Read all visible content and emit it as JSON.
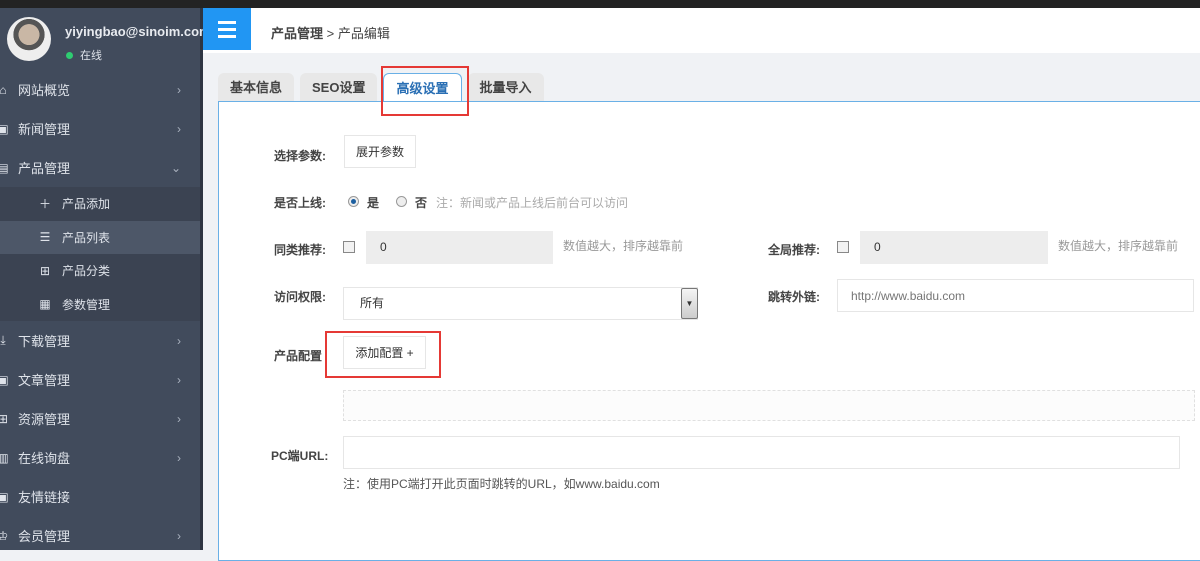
{
  "user": {
    "email": "yiyingbao@sinoim.com",
    "status": "在线"
  },
  "sidebar": {
    "items": [
      {
        "label": "网站概览",
        "icon": "home-icon"
      },
      {
        "label": "新闻管理",
        "icon": "newspaper-icon"
      },
      {
        "label": "产品管理",
        "icon": "file-icon",
        "expanded": true,
        "children": [
          {
            "label": "产品添加",
            "icon": "plus-icon"
          },
          {
            "label": "产品列表",
            "icon": "list-icon",
            "active": true
          },
          {
            "label": "产品分类",
            "icon": "grid-icon"
          },
          {
            "label": "参数管理",
            "icon": "tiles-icon"
          }
        ]
      },
      {
        "label": "下载管理",
        "icon": "download-icon"
      },
      {
        "label": "文章管理",
        "icon": "article-icon"
      },
      {
        "label": "资源管理",
        "icon": "resource-icon"
      },
      {
        "label": "在线询盘",
        "icon": "inquiry-icon"
      },
      {
        "label": "友情链接",
        "icon": "link-icon"
      },
      {
        "label": "会员管理",
        "icon": "member-icon"
      }
    ]
  },
  "header": {
    "breadcrumb_parent": "产品管理",
    "breadcrumb_sep": ">",
    "breadcrumb_current": "产品编辑"
  },
  "tabs": [
    "基本信息",
    "SEO设置",
    "高级设置",
    "批量导入"
  ],
  "active_tab": "高级设置",
  "form": {
    "params_label": "选择参数:",
    "params_button": "展开参数",
    "online_label": "是否上线:",
    "online_yes": "是",
    "online_no": "否",
    "online_value": "是",
    "online_note": "注：新闻或产品上线后前台可以访问",
    "similar_label": "同类推荐:",
    "similar_value": "0",
    "similar_hint": "数值越大，排序越靠前",
    "global_label": "全局推荐:",
    "global_value": "0",
    "global_hint": "数值越大，排序越靠前",
    "access_label": "访问权限:",
    "access_value": "所有",
    "redirect_label": "跳转外链:",
    "redirect_placeholder": "http://www.baidu.com",
    "config_label": "产品配置",
    "config_button": "添加配置 +",
    "pcurl_label": "PC端URL:",
    "pcurl_value": "",
    "pcurl_note": "注：使用PC端打开此页面时跳转的URL，如www.baidu.com"
  },
  "colors": {
    "accent": "#2196f3",
    "sidebar": "#414b5c",
    "highlight": "#e53935"
  }
}
